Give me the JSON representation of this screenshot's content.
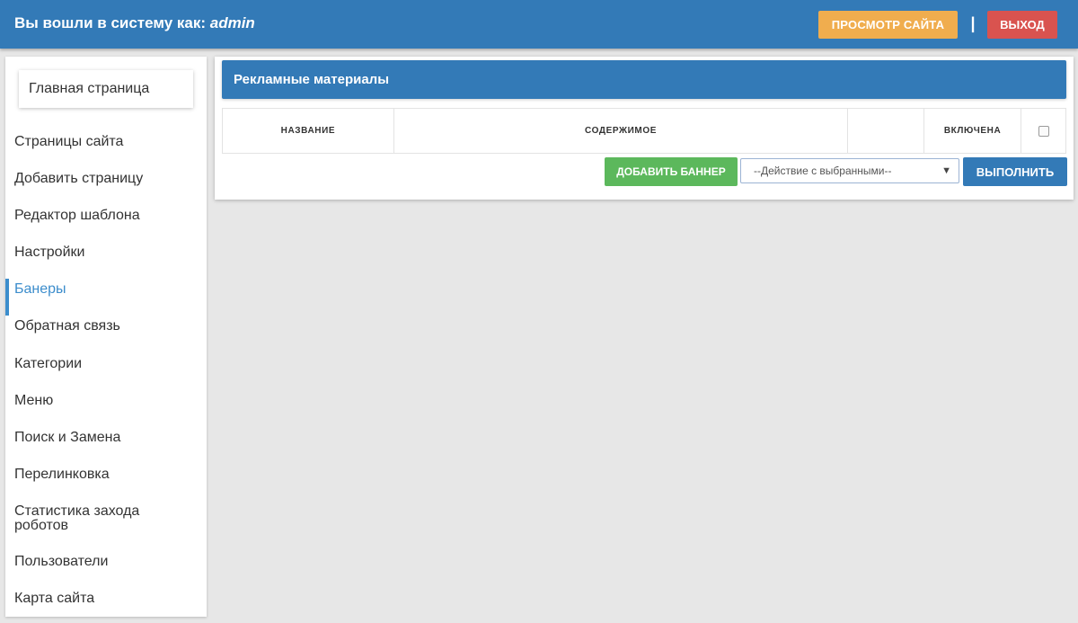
{
  "header": {
    "login_prefix": "Вы вошли в систему как: ",
    "username": "admin",
    "view_site_label": "ПРОСМОТР САЙТА",
    "separator": "|",
    "logout_label": "ВЫХОД"
  },
  "sidebar": {
    "home_label": "Главная страница",
    "active_item": "Банеры",
    "items": [
      {
        "label": "Страницы сайта"
      },
      {
        "label": "Добавить страницу"
      },
      {
        "label": "Редактор шаблона"
      },
      {
        "label": "Настройки"
      },
      {
        "label": "Банеры"
      },
      {
        "label": "Обратная связь"
      },
      {
        "label": "Категории"
      },
      {
        "label": "Меню"
      },
      {
        "label": "Поиск и Замена"
      },
      {
        "label": "Перелинковка"
      },
      {
        "label": "Статистика захода роботов"
      },
      {
        "label": "Пользователи"
      },
      {
        "label": "Карта сайта"
      }
    ]
  },
  "main": {
    "title": "Рекламные материалы",
    "table": {
      "columns": [
        "НАЗВАНИЕ",
        "СОДЕРЖИМОЕ",
        "",
        "ВКЛЮЧЕНА"
      ]
    },
    "add_banner_label": "ДОБАВИТЬ БАННЕР",
    "action_select": {
      "selected": "--Действие с выбранными--"
    },
    "run_label": "ВЫПОЛНИТЬ"
  },
  "colors": {
    "primary": "#337ab7",
    "warning": "#f0ad4e",
    "danger": "#d9534f",
    "success": "#5cb85c",
    "active_link": "#3c8dcc"
  }
}
